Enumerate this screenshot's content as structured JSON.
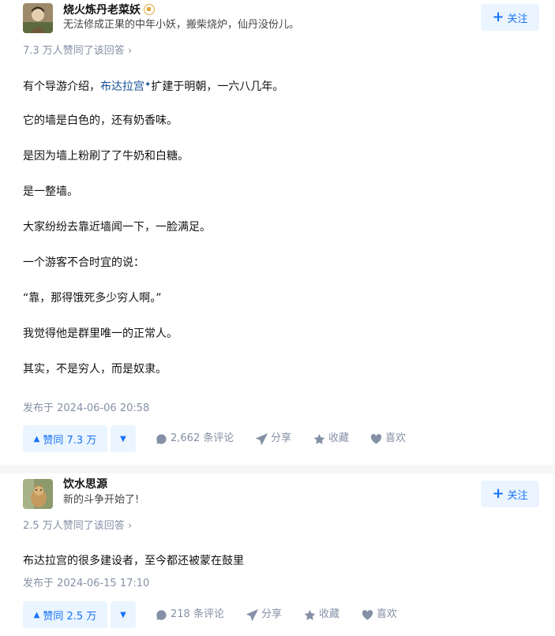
{
  "answers": [
    {
      "author": "烧火炼丹老菜妖",
      "bio": "无法修成正果的中年小妖，搬柴烧炉，仙丹没份儿。",
      "follow_label": "关注",
      "voted": "7.3 万人赞同了该回答 ›",
      "paragraphs": [
        {
          "pre": "有个导游介绍，",
          "link": "布达拉宫",
          "post": "扩建于明朝，一六八几年。"
        },
        {
          "text": "它的墙是白色的，还有奶香味。"
        },
        {
          "text": "是因为墙上粉刷了了牛奶和白糖。"
        },
        {
          "text": "是一整墙。"
        },
        {
          "text": "大家纷纷去靠近墙闻一下，一脸满足。"
        },
        {
          "text": "一个游客不合时宜的说："
        },
        {
          "text": "“靠，那得饿死多少穷人啊。”"
        },
        {
          "text": "我觉得他是群里唯一的正常人。"
        },
        {
          "text": "其实，不是穷人，而是奴隶。"
        }
      ],
      "time": "发布于 2024-06-06 20:58",
      "vote_label": "赞同 7.3 万",
      "comments": "2,662 条评论",
      "share": "分享",
      "collect": "收藏",
      "like": "喜欢"
    },
    {
      "author": "饮水思源",
      "bio": "新的斗争开始了!",
      "follow_label": "关注",
      "voted": "2.5 万人赞同了该回答 ›",
      "paragraphs": [
        {
          "text": "布达拉宫的很多建设者，至今都还被蒙在鼓里"
        }
      ],
      "time": "发布于 2024-06-15 17:10",
      "vote_label": "赞同 2.5 万",
      "comments": "218 条评论",
      "share": "分享",
      "collect": "收藏",
      "like": "喜欢"
    }
  ],
  "colors": {
    "accent": "#1772f6",
    "accent_bg": "#ebf5ff",
    "meta": "#8590a6",
    "link": "#175199"
  },
  "icons": {
    "badge": "badge-icon",
    "plus": "plus-icon",
    "comment": "comment-icon",
    "share": "share-icon",
    "collect": "star-icon",
    "like": "heart-icon",
    "vote_up": "triangle-up-icon",
    "vote_down": "triangle-down-icon"
  }
}
